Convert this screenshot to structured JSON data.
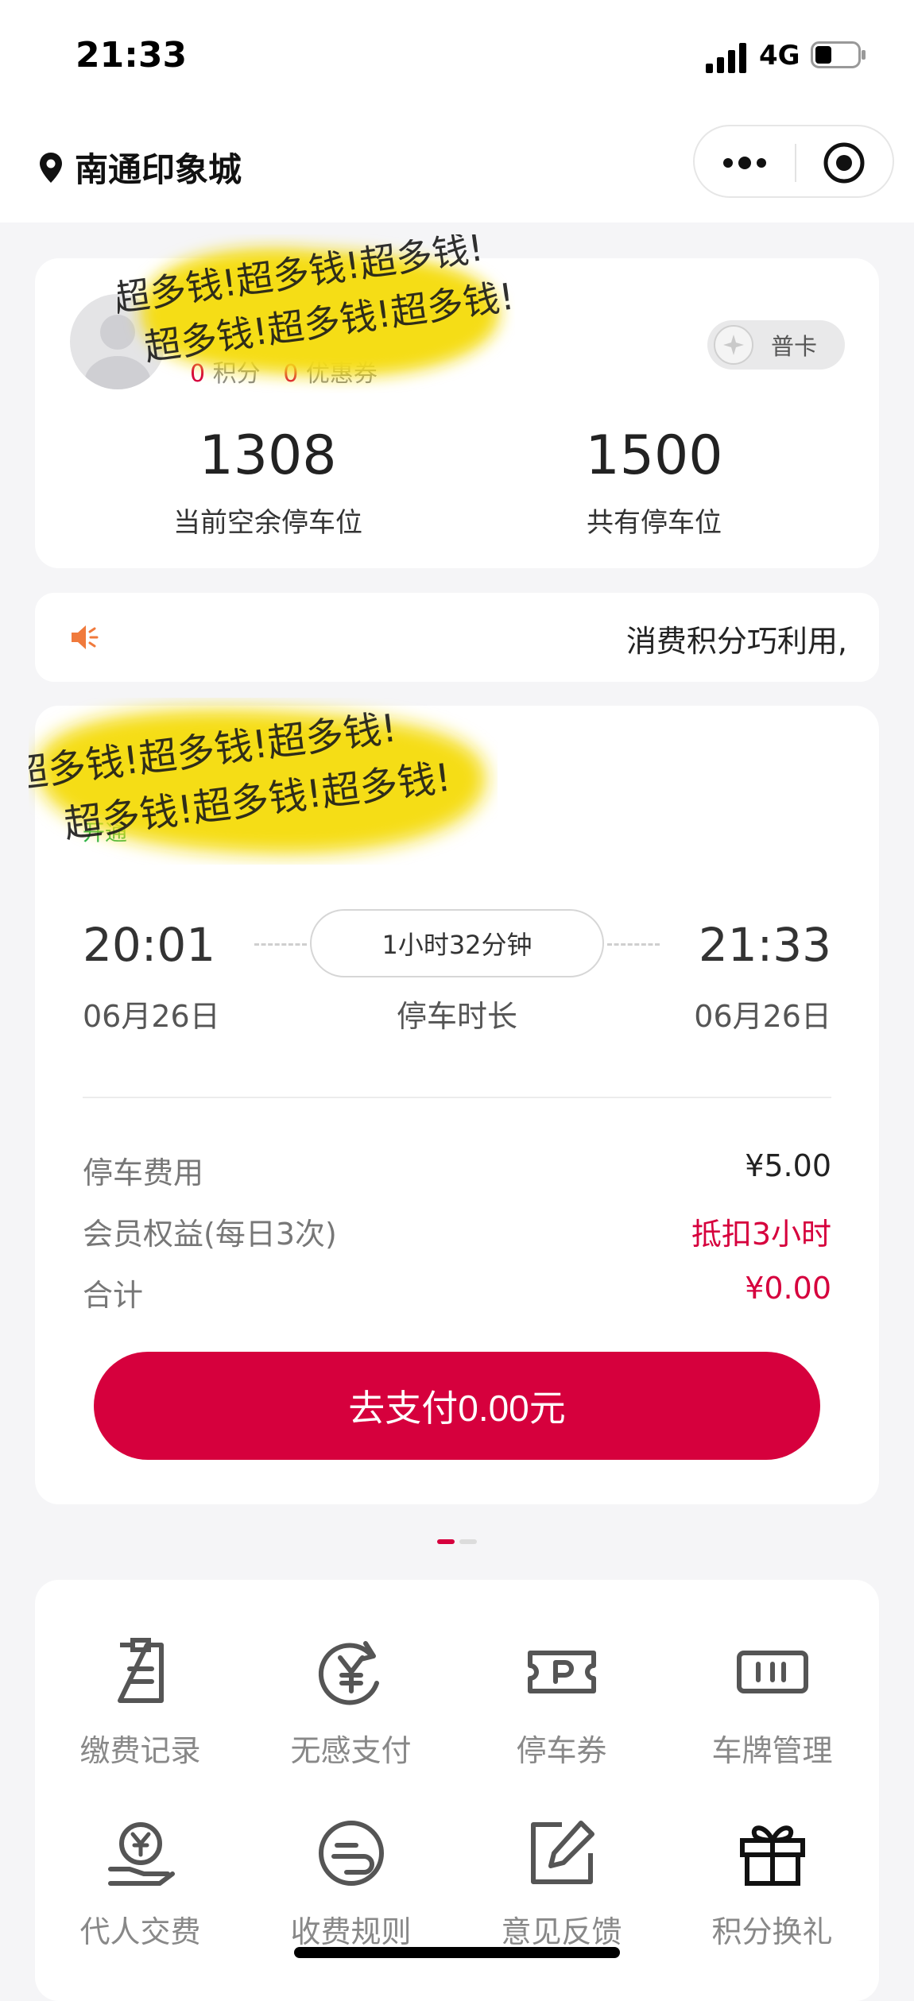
{
  "status_bar": {
    "time": "21:33",
    "network": "4G"
  },
  "nav": {
    "location": "南通印象城"
  },
  "member": {
    "points_value": "0",
    "points_label": "积分",
    "coupons_value": "0",
    "coupons_label": "优惠券",
    "card_type": "普卡",
    "stats": [
      {
        "value": "1308",
        "label": "当前空余停车位"
      },
      {
        "value": "1500",
        "label": "共有停车位"
      }
    ],
    "scribble_text": "超多钱!超多钱!超多钱!"
  },
  "notice": {
    "text": "消费积分巧利用,"
  },
  "parking": {
    "partial_label": "开通",
    "scribble_text": "超多钱!超多钱!超多钱!",
    "entry": {
      "time": "20:01",
      "date": "06月26日"
    },
    "exit": {
      "time": "21:33",
      "date": "06月26日"
    },
    "duration": "1小时32分钟",
    "duration_label": "停车时长",
    "fees": [
      {
        "label": "停车费用",
        "value": "¥5.00",
        "highlight": false
      },
      {
        "label": "会员权益(每日3次)",
        "value": "抵扣3小时",
        "highlight": true
      },
      {
        "label": "合计",
        "value": "¥0.00",
        "highlight": true
      }
    ],
    "pay_button": "去支付0.00元"
  },
  "carousel": {
    "active_index": 0,
    "total": 2
  },
  "services": [
    {
      "label": "缴费记录",
      "icon": "receipt-icon"
    },
    {
      "label": "无感支付",
      "icon": "yuan-cycle-icon"
    },
    {
      "label": "停车券",
      "icon": "parking-ticket-icon"
    },
    {
      "label": "车牌管理",
      "icon": "license-plate-icon"
    },
    {
      "label": "代人交费",
      "icon": "hand-yuan-icon"
    },
    {
      "label": "收费规则",
      "icon": "rules-icon"
    },
    {
      "label": "意见反馈",
      "icon": "feedback-edit-icon"
    },
    {
      "label": "积分换礼",
      "icon": "gift-icon"
    }
  ],
  "colors": {
    "accent": "#d6003d",
    "green": "#25b04a",
    "background": "#f5f5f7"
  }
}
